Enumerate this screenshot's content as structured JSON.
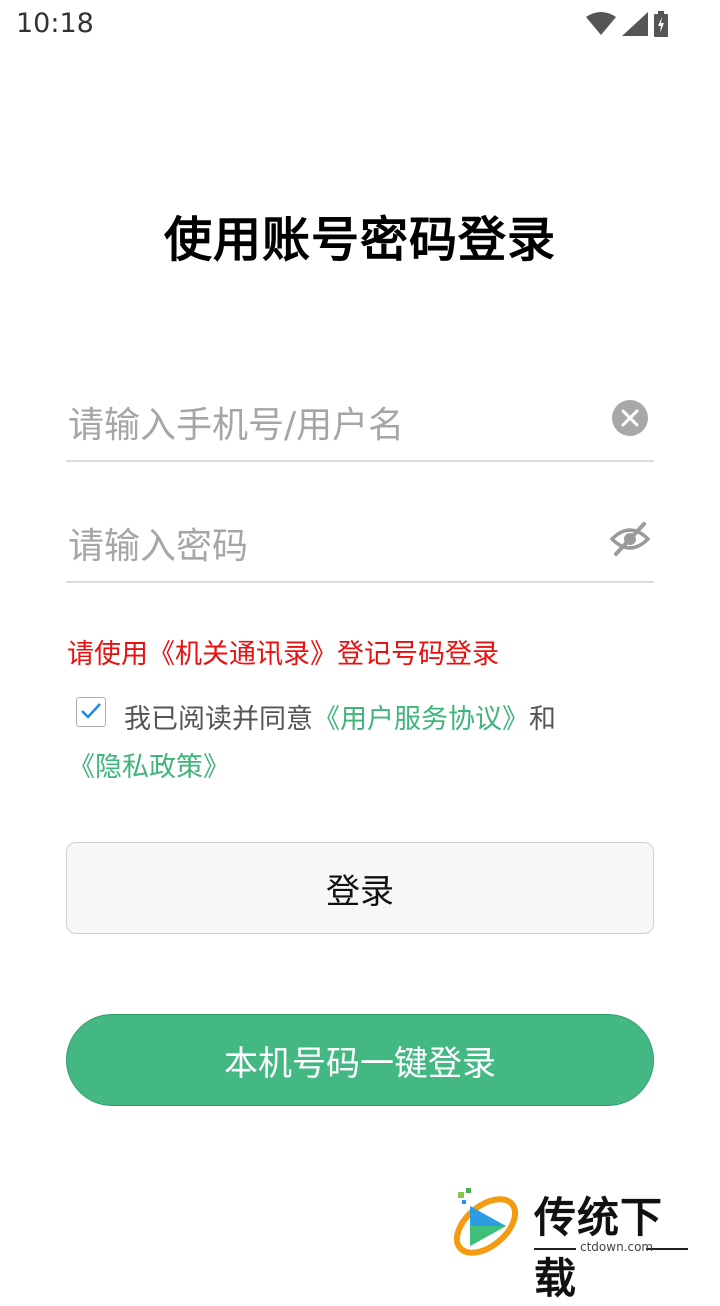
{
  "status_bar": {
    "time": "10:18",
    "icons": [
      "wifi-icon",
      "signal-icon",
      "battery-charging-icon"
    ]
  },
  "page": {
    "title": "使用账号密码登录"
  },
  "form": {
    "phone_placeholder": "请输入手机号/用户名",
    "password_placeholder": "请输入密码",
    "notice": "请使用《机关通讯录》登记号码登录",
    "agreement": {
      "checked": true,
      "prefix": "我已阅读并同意",
      "user_agreement_link": "《用户服务协议》",
      "conjunction": "和",
      "privacy_link": "《隐私政策》"
    },
    "login_label": "登录",
    "one_key_label": "本机号码一键登录"
  },
  "watermark": {
    "title": "传统下载",
    "site": "ctdown.com"
  },
  "colors": {
    "accent_green": "#43b883",
    "link_green": "#3fb57a",
    "notice_red": "#e8110f"
  }
}
